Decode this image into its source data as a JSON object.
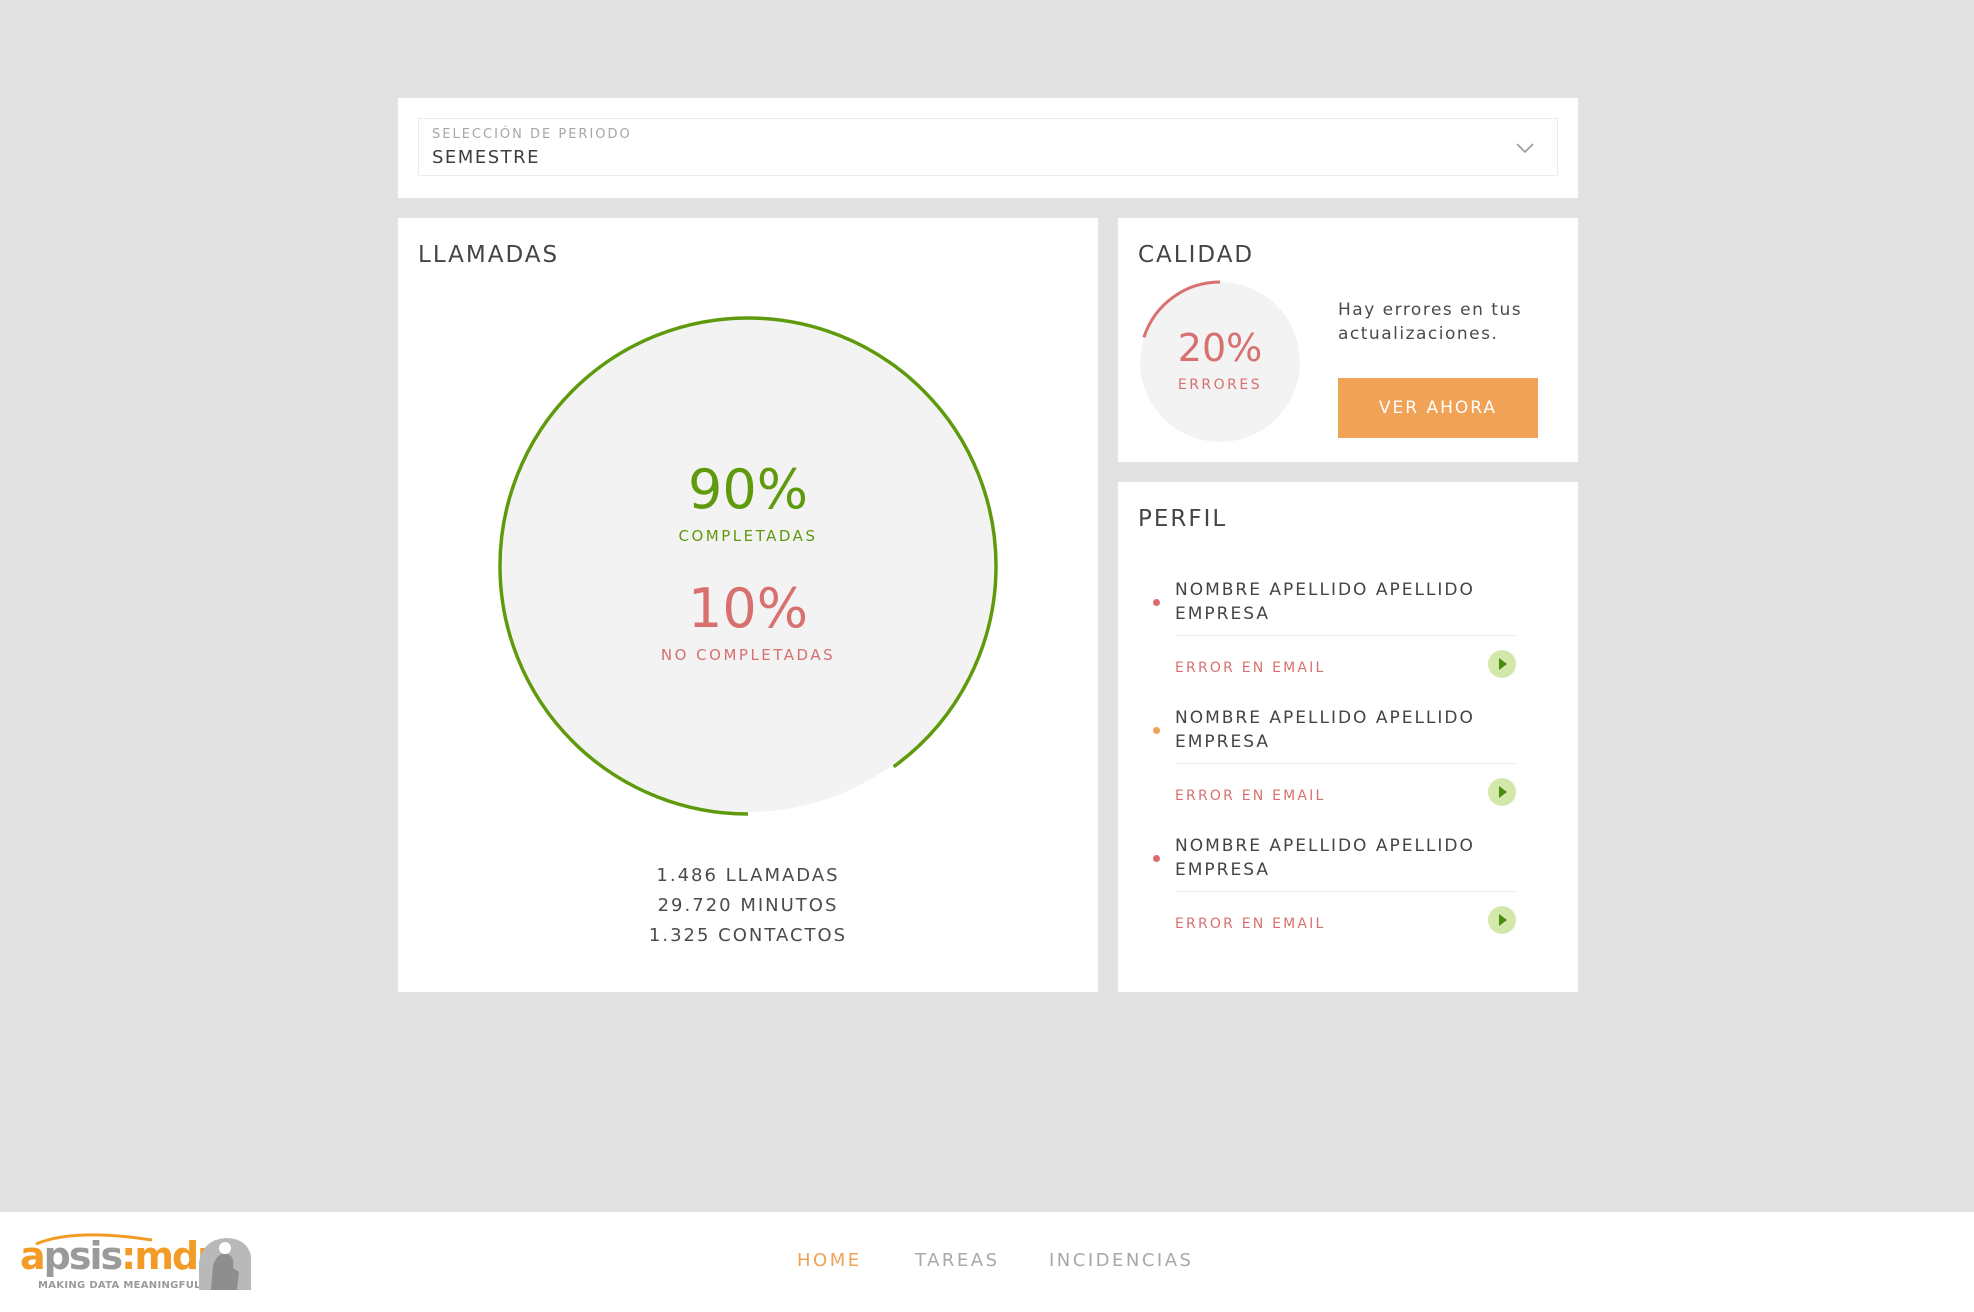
{
  "period": {
    "label": "SELECCIÓN DE PERIODO",
    "value": "SEMESTRE"
  },
  "calls": {
    "title": "LLAMADAS",
    "completed_value": "90%",
    "completed_label": "COMPLETADAS",
    "not_completed_value": "10%",
    "not_completed_label": "NO COMPLETADAS",
    "completed_fraction": 0.9,
    "stats": {
      "calls": "1.486 LLAMADAS",
      "minutes": "29.720 MINUTOS",
      "contacts": "1.325 CONTACTOS"
    }
  },
  "quality": {
    "title": "CALIDAD",
    "value": "20%",
    "label": "ERRORES",
    "error_fraction": 0.2,
    "message": "Hay errores en tus actualizaciones.",
    "button_label": "VER AHORA"
  },
  "profile": {
    "title": "PERFIL",
    "items": [
      {
        "name": "NOMBRE APELLIDO APELLIDO EMPRESA",
        "error": "ERROR EN EMAIL",
        "dot_color": "#d7706f"
      },
      {
        "name": "NOMBRE APELLIDO APELLIDO EMPRESA",
        "error": "ERROR EN EMAIL",
        "dot_color": "#f0a257"
      },
      {
        "name": "NOMBRE APELLIDO APELLIDO EMPRESA",
        "error": "ERROR EN EMAIL",
        "dot_color": "#d7706f"
      }
    ]
  },
  "logo": {
    "word_a": "a",
    "word_psis": "psis",
    "word_mdm": ":mdm",
    "tagline": "MAKING DATA MEANINGFUL"
  },
  "nav": {
    "home": "HOME",
    "tareas": "TAREAS",
    "incidencias": "INCIDENCIAS"
  },
  "colors": {
    "accent": "#f0a257",
    "success": "#5e9a0c",
    "error": "#d7706f",
    "background": "#e2e2e2"
  },
  "icons": {
    "period_chevron": "chevron-down-icon",
    "profile_play": "play-icon"
  }
}
